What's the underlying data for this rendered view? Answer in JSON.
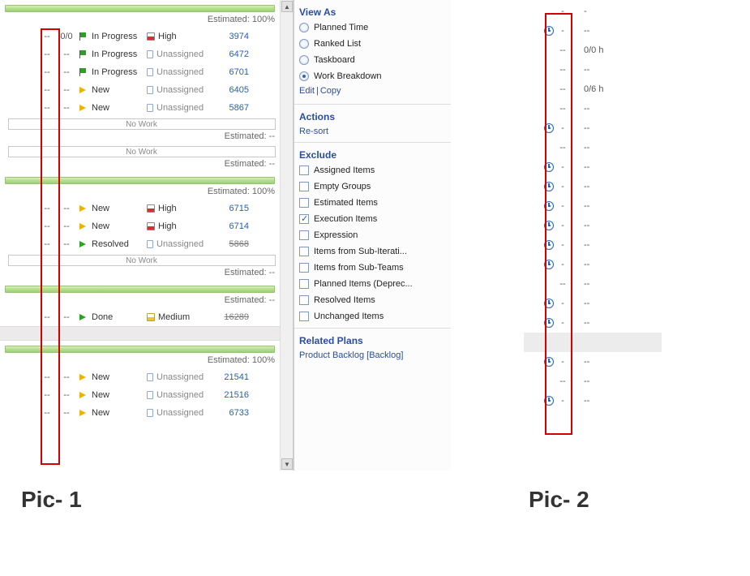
{
  "estimated_label": "Estimated:",
  "blocks": [
    {
      "type": "progress",
      "est": "100%"
    },
    {
      "type": "item",
      "d1": "--",
      "d2": "0/0",
      "status": "In Progress",
      "statusIcon": "green-flag",
      "prio": "High",
      "prioIcon": "high",
      "id": "3974"
    },
    {
      "type": "item",
      "d1": "--",
      "d2": "--",
      "status": "In Progress",
      "statusIcon": "green-flag",
      "prio": "Unassigned",
      "prioIcon": "unassigned",
      "id": "6472"
    },
    {
      "type": "item",
      "d1": "--",
      "d2": "--",
      "status": "In Progress",
      "statusIcon": "green-flag",
      "prio": "Unassigned",
      "prioIcon": "unassigned",
      "id": "6701"
    },
    {
      "type": "item",
      "d1": "--",
      "d2": "--",
      "status": "New",
      "statusIcon": "yellow-arrow",
      "prio": "Unassigned",
      "prioIcon": "unassigned",
      "id": "6405"
    },
    {
      "type": "item",
      "d1": "--",
      "d2": "--",
      "status": "New",
      "statusIcon": "yellow-arrow",
      "prio": "Unassigned",
      "prioIcon": "unassigned",
      "id": "5867"
    },
    {
      "type": "nowork",
      "est": "--"
    },
    {
      "type": "nowork",
      "est": "--"
    },
    {
      "type": "progress",
      "est": "100%"
    },
    {
      "type": "item",
      "d1": "--",
      "d2": "--",
      "status": "New",
      "statusIcon": "yellow-arrow",
      "prio": "High",
      "prioIcon": "high",
      "id": "6715"
    },
    {
      "type": "item",
      "d1": "--",
      "d2": "--",
      "status": "New",
      "statusIcon": "yellow-arrow",
      "prio": "High",
      "prioIcon": "high",
      "id": "6714"
    },
    {
      "type": "item",
      "d1": "--",
      "d2": "--",
      "status": "Resolved",
      "statusIcon": "green-arrow",
      "prio": "Unassigned",
      "prioIcon": "unassigned",
      "id": "5868",
      "struck": true
    },
    {
      "type": "nowork",
      "est": "--"
    },
    {
      "type": "progress",
      "est": "--"
    },
    {
      "type": "item",
      "d1": "--",
      "d2": "--",
      "status": "Done",
      "statusIcon": "green-arrow",
      "prio": "Medium",
      "prioIcon": "medium",
      "id": "16289",
      "struck": true
    },
    {
      "type": "gap"
    },
    {
      "type": "progress",
      "est": "100%"
    },
    {
      "type": "item",
      "d1": "--",
      "d2": "--",
      "status": "New",
      "statusIcon": "yellow-arrow",
      "prio": "Unassigned",
      "prioIcon": "unassigned",
      "id": "21541"
    },
    {
      "type": "item",
      "d1": "--",
      "d2": "--",
      "status": "New",
      "statusIcon": "yellow-arrow",
      "prio": "Unassigned",
      "prioIcon": "unassigned",
      "id": "21516"
    },
    {
      "type": "item",
      "d1": "--",
      "d2": "--",
      "status": "New",
      "statusIcon": "yellow-arrow",
      "prio": "Unassigned",
      "prioIcon": "unassigned",
      "id": "6733"
    }
  ],
  "nowork_label": "No Work",
  "sidebar": {
    "viewAs": {
      "title": "View As",
      "options": [
        {
          "label": "Planned Time",
          "selected": false
        },
        {
          "label": "Ranked List",
          "selected": false
        },
        {
          "label": "Taskboard",
          "selected": false
        },
        {
          "label": "Work Breakdown",
          "selected": true
        }
      ]
    },
    "editLabel": "Edit",
    "copyLabel": "Copy",
    "actions": {
      "title": "Actions",
      "resort": "Re-sort"
    },
    "exclude": {
      "title": "Exclude",
      "items": [
        {
          "label": "Assigned Items",
          "checked": false
        },
        {
          "label": "Empty Groups",
          "checked": false
        },
        {
          "label": "Estimated Items",
          "checked": false
        },
        {
          "label": "Execution Items",
          "checked": true
        },
        {
          "label": "Expression",
          "checked": false
        },
        {
          "label": "Items from Sub-Iterati...",
          "checked": false
        },
        {
          "label": "Items from Sub-Teams",
          "checked": false
        },
        {
          "label": "Planned Items (Deprec...",
          "checked": false
        },
        {
          "label": "Resolved Items",
          "checked": false
        },
        {
          "label": "Unchanged Items",
          "checked": false
        }
      ]
    },
    "related": {
      "title": "Related Plans",
      "link": "Product Backlog [Backlog]"
    }
  },
  "pic2_rows": [
    {
      "icon": false,
      "d": "-",
      "v": "-"
    },
    {
      "icon": true,
      "d": "-",
      "v": "--"
    },
    {
      "icon": false,
      "d": "--",
      "v": "0/0 h"
    },
    {
      "icon": false,
      "d": "--",
      "v": "--"
    },
    {
      "icon": false,
      "d": "--",
      "v": "0/6 h"
    },
    {
      "icon": false,
      "d": "--",
      "v": "--"
    },
    {
      "icon": true,
      "d": "-",
      "v": "--"
    },
    {
      "icon": false,
      "d": "--",
      "v": "--"
    },
    {
      "icon": true,
      "d": "-",
      "v": "--"
    },
    {
      "icon": true,
      "d": "-",
      "v": "--"
    },
    {
      "icon": true,
      "d": "-",
      "v": "--"
    },
    {
      "icon": true,
      "d": "-",
      "v": "--"
    },
    {
      "icon": true,
      "d": "-",
      "v": "--"
    },
    {
      "icon": true,
      "d": "-",
      "v": "--"
    },
    {
      "icon": false,
      "d": "--",
      "v": "--"
    },
    {
      "icon": true,
      "d": "-",
      "v": "--"
    },
    {
      "icon": true,
      "d": "-",
      "v": "--"
    },
    {
      "type": "gap"
    },
    {
      "icon": true,
      "d": "-",
      "v": "--"
    },
    {
      "icon": false,
      "d": "--",
      "v": "--"
    },
    {
      "icon": true,
      "d": "-",
      "v": "--"
    }
  ],
  "labels": {
    "pic1": "Pic- 1",
    "pic2": "Pic- 2"
  }
}
